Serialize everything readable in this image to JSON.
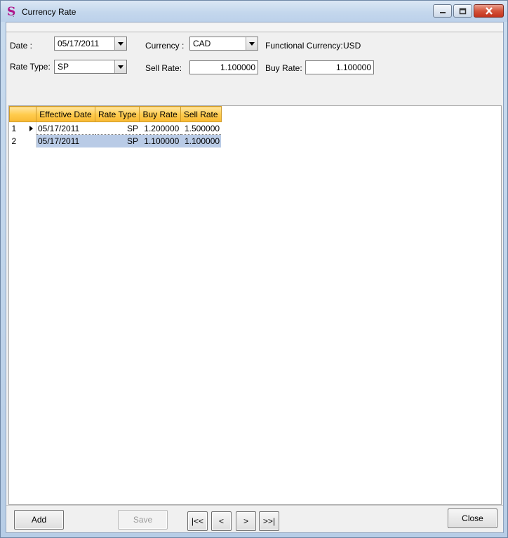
{
  "window": {
    "title": "Currency Rate",
    "controls": {
      "minimize": "minimize-button",
      "maximize": "maximize-button",
      "close": "close-button"
    }
  },
  "form": {
    "date_label": "Date :",
    "date_value": "05/17/2011",
    "currency_label": "Currency :",
    "currency_value": "CAD",
    "functional_currency_label": "Functional Currency:",
    "functional_currency_value": "USD",
    "rate_type_label": "Rate Type:",
    "rate_type_value": "SP",
    "sell_rate_label": "Sell Rate:",
    "sell_rate_value": "1.100000",
    "buy_rate_label": "Buy Rate:",
    "buy_rate_value": "1.100000"
  },
  "grid": {
    "columns": [
      "Effective Date",
      "Rate Type",
      "Buy Rate",
      "Sell Rate"
    ],
    "rows": [
      {
        "num": "1",
        "effective_date": "05/17/2011",
        "rate_type": "SP",
        "buy_rate": "1.200000",
        "sell_rate": "1.500000",
        "current": true
      },
      {
        "num": "2",
        "effective_date": "05/17/2011",
        "rate_type": "SP",
        "buy_rate": "1.100000",
        "sell_rate": "1.100000",
        "selected": true
      }
    ]
  },
  "buttons": {
    "add": "Add",
    "save": "Save",
    "first": "|<<",
    "prev": "<",
    "next": ">",
    "last": ">>|",
    "close": "Close"
  },
  "colors": {
    "header_gradient_top": "#ffe6a2",
    "header_gradient_bottom": "#f8b833",
    "selected_row": "#b9cbe6",
    "title_bar": "#c4d7ed"
  }
}
